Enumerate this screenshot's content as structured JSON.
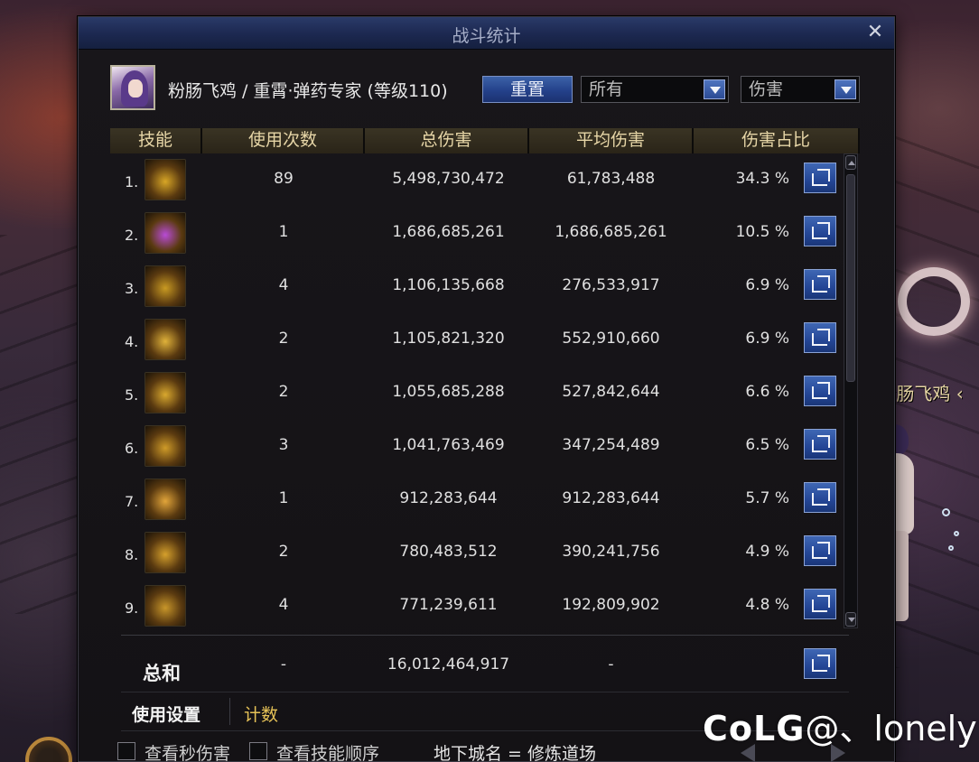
{
  "window": {
    "title": "战斗统计",
    "close_icon": "✕"
  },
  "character": {
    "info": "粉肠飞鸡 / 重霄·弹药专家 (等级110)"
  },
  "controls": {
    "reset_label": "重置",
    "filter_target": "所有",
    "filter_type": "伤害"
  },
  "table": {
    "headers": [
      "技能",
      "使用次数",
      "总伤害",
      "平均伤害",
      "伤害占比"
    ],
    "rows": [
      {
        "rank": "1.",
        "uses": "89",
        "total": "5,498,730,472",
        "avg": "61,783,488",
        "pct": "34.3 %",
        "icon": "grenade-skill-icon",
        "color": "#d8a626"
      },
      {
        "rank": "2.",
        "uses": "1",
        "total": "1,686,685,261",
        "avg": "1,686,685,261",
        "pct": "10.5 %",
        "icon": "purple-laser-skill-icon",
        "color": "#b84bd6"
      },
      {
        "rank": "3.",
        "uses": "4",
        "total": "1,106,135,668",
        "avg": "276,533,917",
        "pct": "6.9 %",
        "icon": "flame-ring-skill-icon",
        "color": "#c99a22"
      },
      {
        "rank": "4.",
        "uses": "2",
        "total": "1,105,821,320",
        "avg": "552,910,660",
        "pct": "6.9 %",
        "icon": "explosion-tree-skill-icon",
        "color": "#e0b23a"
      },
      {
        "rank": "5.",
        "uses": "2",
        "total": "1,055,685,288",
        "avg": "527,842,644",
        "pct": "6.6 %",
        "icon": "blast-burst-skill-icon",
        "color": "#d9a82e"
      },
      {
        "rank": "6.",
        "uses": "3",
        "total": "1,041,763,469",
        "avg": "347,254,489",
        "pct": "6.5 %",
        "icon": "spiral-skill-icon",
        "color": "#cf9b28"
      },
      {
        "rank": "7.",
        "uses": "1",
        "total": "912,283,644",
        "avg": "912,283,644",
        "pct": "5.7 %",
        "icon": "bullet-rain-skill-icon",
        "color": "#e2a53a"
      },
      {
        "rank": "8.",
        "uses": "2",
        "total": "780,483,512",
        "avg": "390,241,756",
        "pct": "4.9 %",
        "icon": "ground-blast-skill-icon",
        "color": "#d5a02c"
      },
      {
        "rank": "9.",
        "uses": "4",
        "total": "771,239,611",
        "avg": "192,809,902",
        "pct": "4.8 %",
        "icon": "rocket-skill-icon",
        "color": "#c8962a"
      }
    ],
    "summary": {
      "label": "总和",
      "uses": "-",
      "total": "16,012,464,917",
      "avg": "-"
    }
  },
  "tabs": {
    "settings": "使用设置",
    "count": "计数"
  },
  "options": {
    "show_dps": "查看秒伤害",
    "show_skill_order": "查看技能顺序",
    "dungeon": "地下城名 = 修炼道场"
  },
  "scene": {
    "npc_name": "者 粉肠飞鸡 ‹"
  },
  "watermark": {
    "logo": "CoLG",
    "handle": "@、lonely"
  },
  "colors": {
    "title_blue": "#1c2850",
    "header_gold": "#e7d6a7",
    "tab_gold": "#e6c257",
    "button_blue": "#24418a"
  }
}
